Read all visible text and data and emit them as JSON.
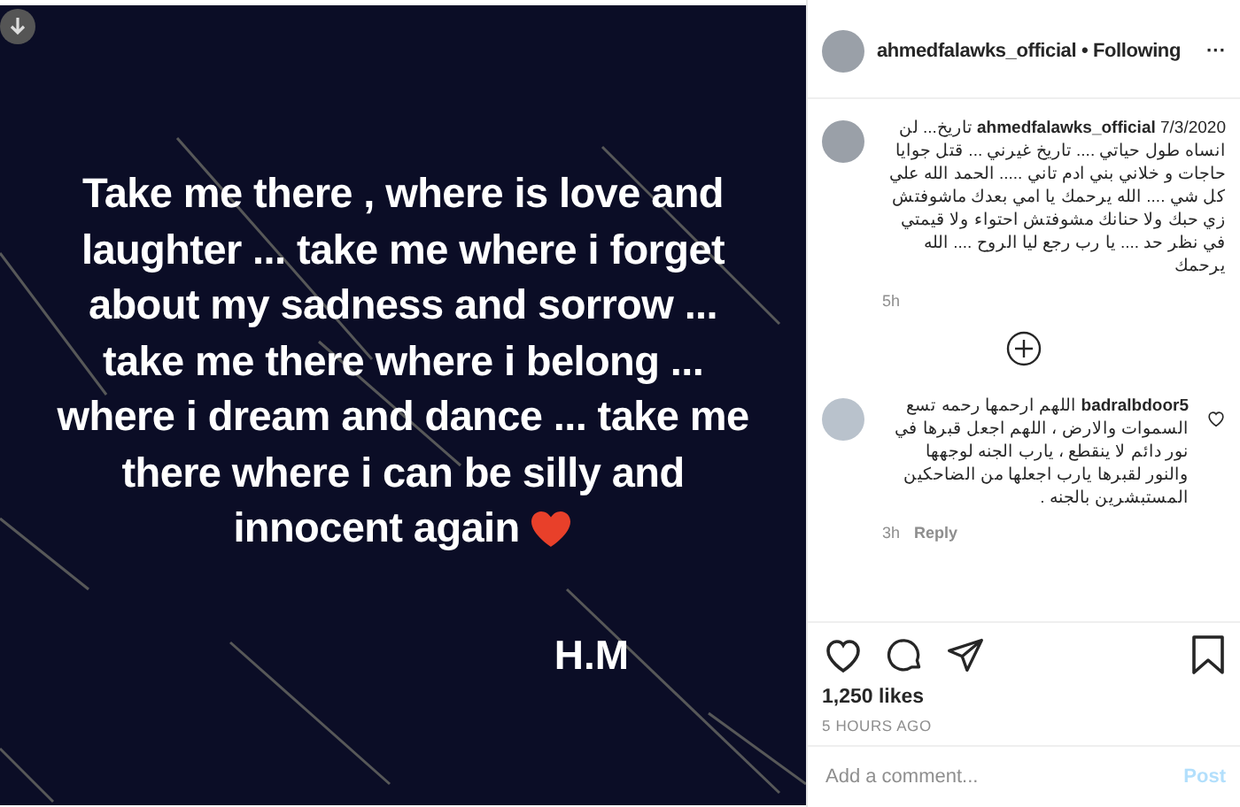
{
  "post_image": {
    "lines": [
      "Take me there , where is love and",
      "laughter ... take me where i forget",
      "about my sadness and sorrow ...",
      "take me there where i belong ...",
      "where i dream and dance ... take me",
      "there where i can be silly and",
      "innocent again"
    ],
    "signature": "H.M"
  },
  "header": {
    "username": "ahmedfalawks_official",
    "separator": "•",
    "follow_status": "Following",
    "more": "···"
  },
  "caption": {
    "text": "**ahmedfalawks_official** 7/3/2020 تاريخ... لن انساه طول حياتي .... تاريخ غيرني ... قتل جوايا حاجات و خلاني بني ادم تاني ..... الحمد الله علي كل شي .... الله يرحمك يا امي بعدك ماشوفتش زي حبك ولا حنانك مشوفتش احتواء ولا قيمتي في نظر حد .... يا رب رجع ليا الروح .... الله يرحمك",
    "time": "5h"
  },
  "comments": [
    {
      "text": "**badralbdoor5** اللهم ارحمها رحمه تسع السموات والارض ، اللهم اجعل قبرها في نور دائم لا ينقطع ، يارب الجنه لوجهها والنور لقبرها يارب اجعلها من الضاحكين المستبشرين بالجنه .",
      "time": "3h",
      "reply": "Reply",
      "liked": false
    }
  ],
  "actions": {
    "liked": false,
    "saved": false
  },
  "likes": "1,250 likes",
  "posted": "5 HOURS AGO",
  "comment_box": {
    "placeholder": "Add a comment...",
    "post": "Post",
    "disabled": true
  }
}
